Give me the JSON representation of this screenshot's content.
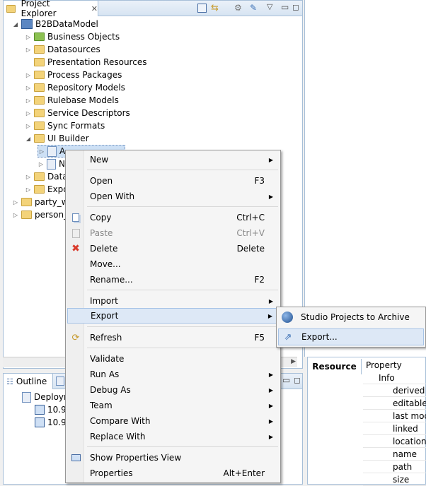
{
  "project_explorer": {
    "tab_label": "Project Explorer",
    "tree": {
      "root": "B2BDataModel",
      "children": [
        "Business Objects",
        "Datasources",
        "Presentation Resources",
        "Process Packages",
        "Repository Models",
        "Rulebase Models",
        "Service Descriptors",
        "Sync Formats",
        "UI Builder"
      ],
      "ui_builder_children_partial": [
        "A",
        "N"
      ],
      "partial_items": [
        "Data",
        "Expo"
      ],
      "other_projects": [
        "party_w",
        "person_"
      ]
    }
  },
  "outline": {
    "tab_label": "Outline",
    "root_partial": "Deploym",
    "items": [
      "10.9",
      "10.9"
    ]
  },
  "properties": {
    "tab_label": "Resource",
    "column_header": "Property",
    "group": "Info",
    "rows": [
      "derived",
      "editable",
      "last modi",
      "linked",
      "location",
      "name",
      "path",
      "size"
    ]
  },
  "context_menu": {
    "items": [
      {
        "label": "New",
        "submenu": true
      },
      {
        "label": "Open",
        "shortcut": "F3"
      },
      {
        "label": "Open With",
        "submenu": true
      },
      {
        "label": "Copy",
        "shortcut": "Ctrl+C",
        "icon": "copy-icon"
      },
      {
        "label": "Paste",
        "shortcut": "Ctrl+V",
        "icon": "paste-icon",
        "disabled": true
      },
      {
        "label": "Delete",
        "shortcut": "Delete",
        "icon": "delete-icon"
      },
      {
        "label": "Move..."
      },
      {
        "label": "Rename...",
        "shortcut": "F2"
      },
      {
        "label": "Import",
        "submenu": true
      },
      {
        "label": "Export",
        "submenu": true,
        "highlighted": true
      },
      {
        "label": "Refresh",
        "shortcut": "F5",
        "icon": "refresh-icon"
      },
      {
        "label": "Validate"
      },
      {
        "label": "Run As",
        "submenu": true
      },
      {
        "label": "Debug As",
        "submenu": true
      },
      {
        "label": "Team",
        "submenu": true
      },
      {
        "label": "Compare With",
        "submenu": true
      },
      {
        "label": "Replace With",
        "submenu": true
      },
      {
        "label": "Show Properties View",
        "icon": "properties-view-icon"
      },
      {
        "label": "Properties",
        "shortcut": "Alt+Enter"
      }
    ]
  },
  "export_submenu": {
    "items": [
      {
        "label": "Studio Projects to Archive",
        "icon": "studio-archive-icon"
      },
      {
        "label": "Export...",
        "icon": "export-wizard-icon",
        "highlighted": true
      }
    ]
  },
  "colors": {
    "highlight_bg": "#dde8f6",
    "highlight_border": "#a6c3e6",
    "panel_border": "#a7bfd8",
    "delete_red": "#d93a2b"
  }
}
